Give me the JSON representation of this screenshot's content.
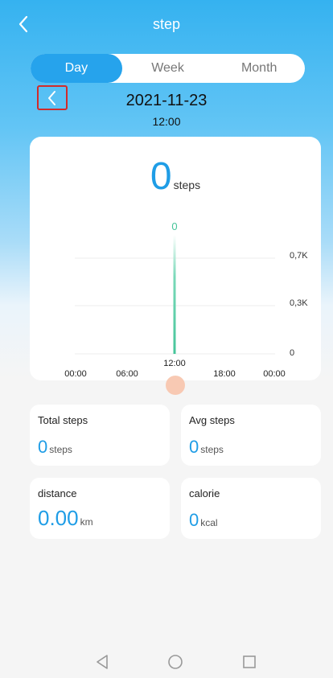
{
  "header": {
    "back_icon": "chevron-left-icon",
    "title": "step"
  },
  "tabs": [
    {
      "label": "Day",
      "active": true
    },
    {
      "label": "Week",
      "active": false
    },
    {
      "label": "Month",
      "active": false
    }
  ],
  "date_nav": {
    "prev_icon": "chevron-left-icon",
    "date": "2021-11-23",
    "time": "12:00"
  },
  "summary": {
    "value": "0",
    "unit": "steps"
  },
  "chart_data": {
    "type": "bar",
    "categories": [
      "12:00"
    ],
    "values": [
      0
    ],
    "value_label": "0",
    "x_tick_labels": [
      "00:00",
      "06:00",
      "12:00",
      "18:00",
      "00:00"
    ],
    "y_tick_labels": [
      "0,7K",
      "0,3K",
      "0"
    ],
    "selected_label": "12:00",
    "grid": true,
    "bar_color": "#46c59a"
  },
  "stats": {
    "total": {
      "label": "Total steps",
      "value": "0",
      "unit": "steps"
    },
    "avg": {
      "label": "Avg steps",
      "value": "0",
      "unit": "steps"
    },
    "distance": {
      "label": "distance",
      "value": "0.00",
      "unit": "km"
    },
    "calorie": {
      "label": "calorie",
      "value": "0",
      "unit": "kcal"
    }
  },
  "colors": {
    "accent": "#1f9de6",
    "tab_active": "#26a3ec",
    "highlight_border": "#d12b2b",
    "handle": "#f8c9b3"
  },
  "system_nav": {
    "back_icon": "triangle-back-icon",
    "home_icon": "circle-home-icon",
    "recents_icon": "square-recents-icon"
  }
}
